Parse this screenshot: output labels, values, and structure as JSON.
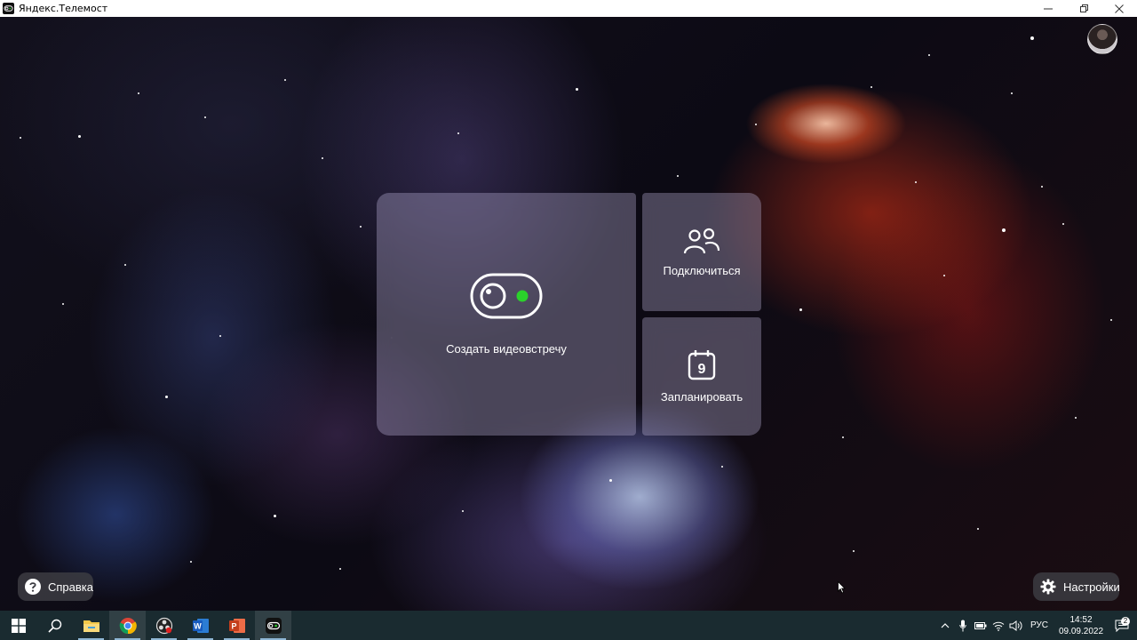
{
  "window": {
    "title": "Яндекс.Телемост",
    "app_icon": "telemost-icon",
    "controls": [
      "minimize-icon",
      "maximize-icon",
      "close-icon"
    ]
  },
  "user": {
    "avatar": "avatar"
  },
  "main": {
    "create": {
      "label": "Создать видеовстречу",
      "icon": "camera-toggle-icon",
      "accent": "#2bd12b"
    },
    "join": {
      "label": "Подключиться",
      "icon": "people-icon"
    },
    "schedule": {
      "label": "Запланировать",
      "icon": "calendar-icon",
      "day": "9"
    }
  },
  "footer": {
    "help": {
      "label": "Справка",
      "icon": "question-icon"
    },
    "settings": {
      "label": "Настройки",
      "icon": "gear-icon"
    }
  },
  "taskbar": {
    "apps": [
      "windows-start-icon",
      "search-icon",
      "file-explorer-icon",
      "chrome-icon",
      "obs-icon",
      "word-icon",
      "powerpoint-icon",
      "telemost-icon"
    ],
    "tray": {
      "icons": [
        "chevron-up-icon",
        "microphone-icon",
        "battery-icon",
        "wifi-icon",
        "volume-icon"
      ],
      "language": "РУС",
      "time": "14:52",
      "date": "09.09.2022",
      "notifications": "2"
    }
  },
  "colors": {
    "taskbar": "#1a2b30",
    "panel": "rgba(205,195,235,0.32)"
  }
}
